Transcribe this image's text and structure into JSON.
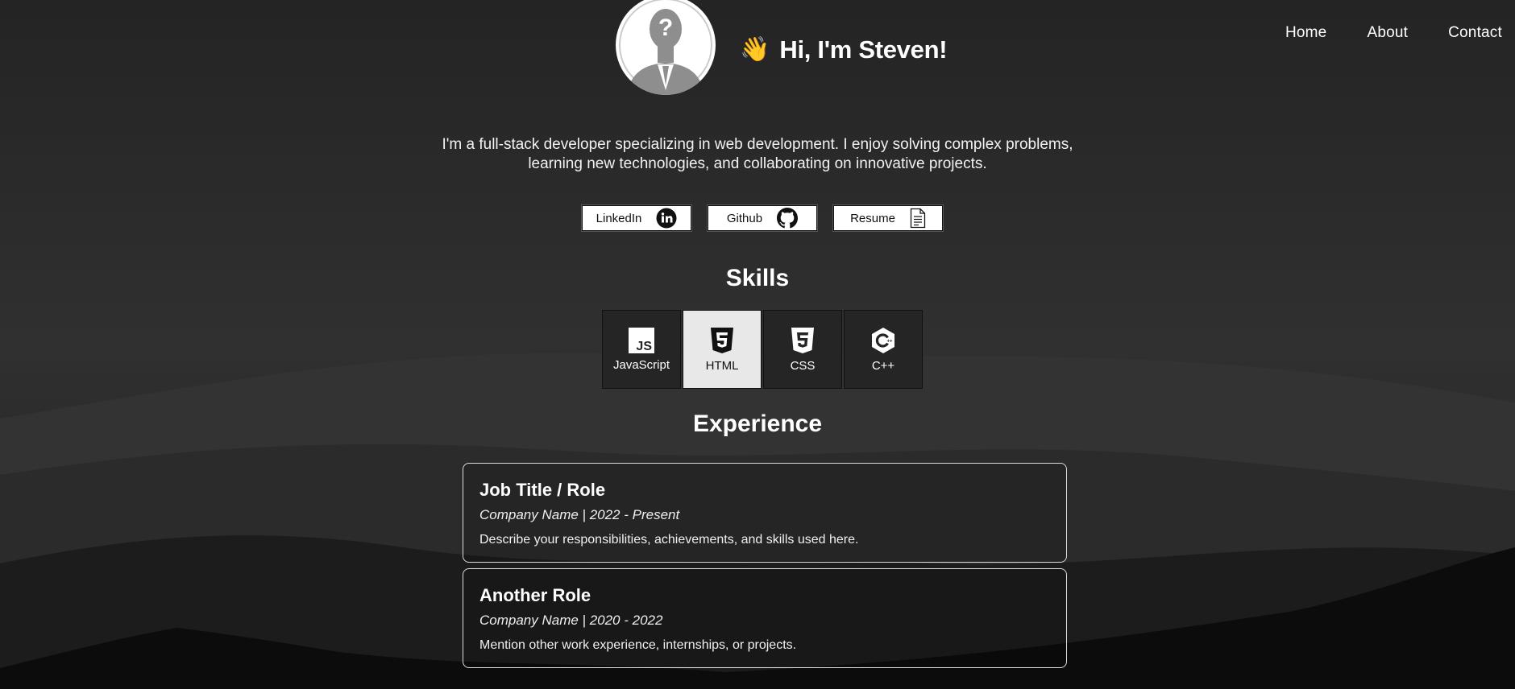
{
  "nav": {
    "items": [
      "Home",
      "About",
      "Contact"
    ]
  },
  "header": {
    "wave_emoji": "👋",
    "greeting": "Hi, I'm Steven!"
  },
  "bio": {
    "text": "I'm a full-stack developer specializing in web development. I enjoy solving complex problems, learning new technologies, and collaborating on innovative projects."
  },
  "links": [
    {
      "label": "LinkedIn",
      "icon": "linkedin-icon"
    },
    {
      "label": "Github",
      "icon": "github-icon"
    },
    {
      "label": "Resume",
      "icon": "document-icon"
    }
  ],
  "skills": {
    "title": "Skills",
    "items": [
      {
        "label": "JavaScript",
        "icon": "javascript-icon"
      },
      {
        "label": "HTML",
        "icon": "html5-icon"
      },
      {
        "label": "CSS",
        "icon": "css3-icon"
      },
      {
        "label": "C++",
        "icon": "cpp-icon"
      }
    ]
  },
  "experience": {
    "title": "Experience",
    "items": [
      {
        "role": "Job Title / Role",
        "meta": "Company Name | 2022 - Present",
        "desc": "Describe your responsibilities, achievements, and skills used here."
      },
      {
        "role": "Another Role",
        "meta": "Company Name | 2020 - 2022",
        "desc": "Mention other work experience, internships, or projects."
      }
    ]
  },
  "colors": {
    "background": "#2a2a2a",
    "text": "#ffffff",
    "active_skill_bg": "#e8e8e8"
  }
}
